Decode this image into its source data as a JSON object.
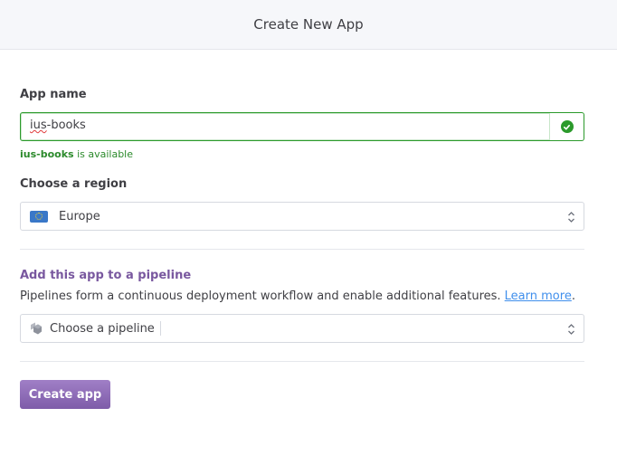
{
  "header": {
    "title": "Create New App"
  },
  "app_name": {
    "label": "App name",
    "value": "ius-books",
    "spell_part": "ius",
    "rest_part": "-books",
    "status_icon": "check-circle-icon",
    "availability_name": "ius-books",
    "availability_text": " is available"
  },
  "region": {
    "label": "Choose a region",
    "selected": "Europe",
    "icon": "eu-flag-icon"
  },
  "pipeline": {
    "heading": "Add this app to a pipeline",
    "description": "Pipelines form a continuous deployment workflow and enable additional features. ",
    "learn_more": "Learn more",
    "period": ".",
    "select_placeholder": "Choose a pipeline",
    "icon": "pipeline-icon"
  },
  "actions": {
    "create_label": "Create app"
  },
  "colors": {
    "success": "#2b9a2b",
    "pipeline_heading": "#79589f",
    "link": "#408fec",
    "button": "#8f6cb8"
  }
}
